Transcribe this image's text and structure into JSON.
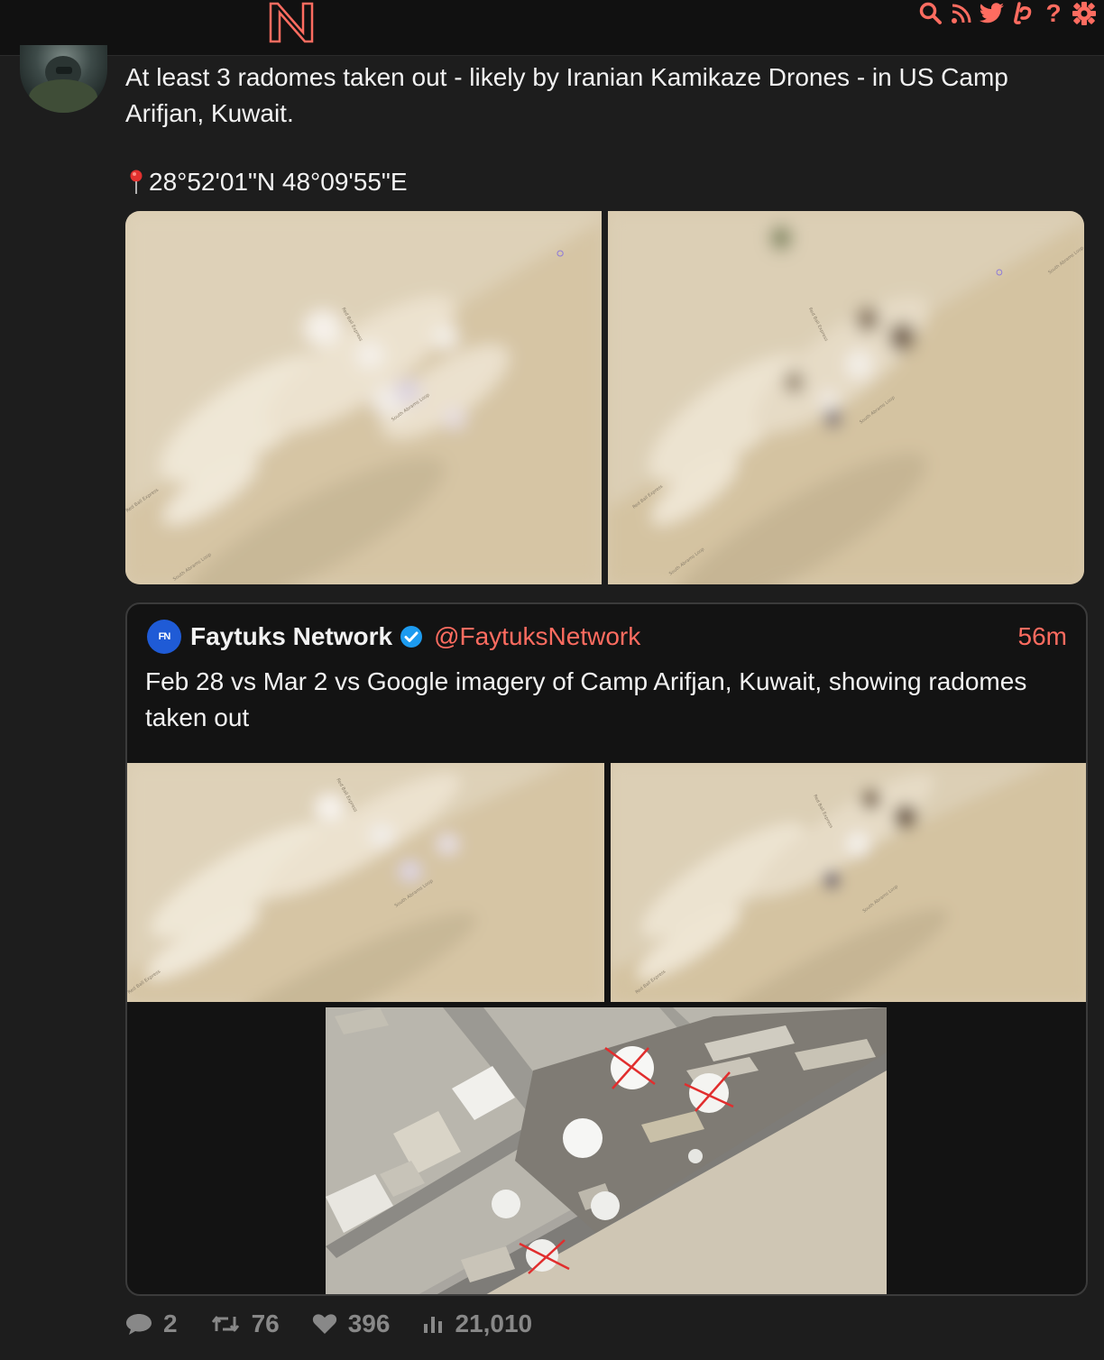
{
  "navbar": {
    "logo_letter": "N",
    "icons": [
      "search-icon",
      "rss-icon",
      "twitter-icon",
      "liberapay-icon",
      "help-icon",
      "settings-icon"
    ],
    "help_label": "?"
  },
  "tweet": {
    "text": "At least 3 radomes taken out - likely by Iranian Kamikaze Drones - in US Camp Arifjan, Kuwait.",
    "coordinates": "28°52'01\"N 48°09'55\"E",
    "images": [
      {
        "labels": [
          "Red Ball Express",
          "South Abrams Loop",
          "Red Ball Express",
          "South Abrams Loop"
        ]
      },
      {
        "labels": [
          "Red Ball Express",
          "South Abrams Loop",
          "Red Ball Express",
          "South Abrams Loop",
          "South Abrams Loop"
        ]
      }
    ]
  },
  "quote": {
    "avatar_text": "FN",
    "name": "Faytuks Network",
    "handle": "@FaytuksNetwork",
    "time": "56m",
    "text": "Feb 28 vs Mar 2 vs Google imagery of Camp Arifjan, Kuwait, showing radomes taken out"
  },
  "stats": {
    "replies": "2",
    "retweets": "76",
    "likes": "396",
    "views": "21,010"
  },
  "colors": {
    "accent": "#ff6c60",
    "background": "#1d1d1d",
    "navbar": "#111111",
    "muted": "#888888"
  }
}
